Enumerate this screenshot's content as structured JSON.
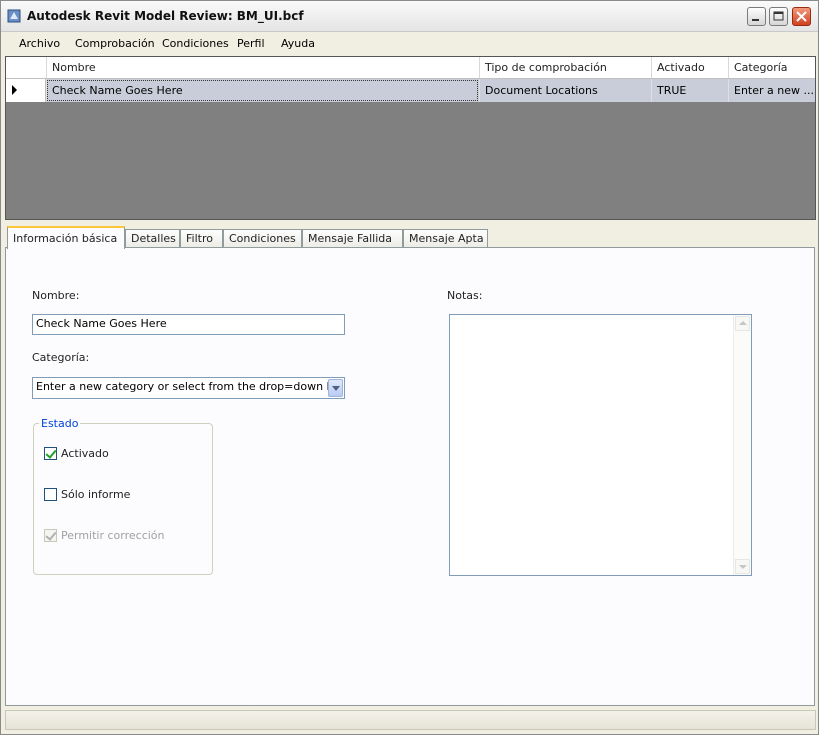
{
  "window": {
    "title": "Autodesk Revit Model Review: BM_UI.bcf",
    "icon": "revit-app-icon"
  },
  "menu": {
    "items": [
      {
        "label": "Archivo"
      },
      {
        "label": "Comprobación"
      },
      {
        "label": "Condiciones"
      },
      {
        "label": "Perfil"
      },
      {
        "label": "Ayuda"
      }
    ]
  },
  "grid": {
    "columns": [
      "Nombre",
      "Tipo de comprobación",
      "Activado",
      "Categoría"
    ],
    "rows": [
      [
        "Check Name Goes Here",
        "Document Locations",
        "TRUE",
        "Enter a new ..."
      ]
    ]
  },
  "tabs": [
    {
      "label": "Información básica",
      "active": true
    },
    {
      "label": "Detalles"
    },
    {
      "label": "Filtro"
    },
    {
      "label": "Condiciones"
    },
    {
      "label": "Mensaje Fallida"
    },
    {
      "label": "Mensaje Apta"
    }
  ],
  "form": {
    "name_label": "Nombre:",
    "name_value": "Check Name Goes Here",
    "category_label": "Categoría:",
    "category_value": "Enter a new category or select from the drop=down li",
    "notes_label": "Notas:",
    "notes_value": ""
  },
  "estado": {
    "title": "Estado",
    "activado": {
      "label": "Activado",
      "checked": true
    },
    "solo_informe": {
      "label": "Sólo informe",
      "checked": false
    },
    "permitir": {
      "label": "Permitir corrección",
      "checked": true,
      "disabled": true
    }
  },
  "colors": {
    "grid_background": "#808080",
    "selected_row": "#c9cdd9",
    "active_tab_accent": "#ffc83c",
    "group_title": "#0046d5"
  }
}
